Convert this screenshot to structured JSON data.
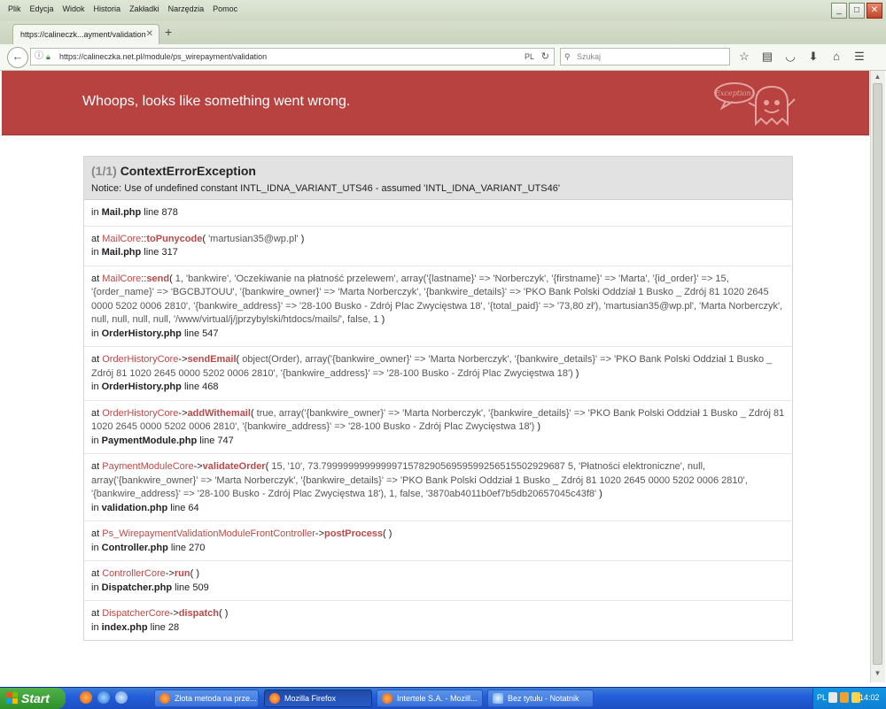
{
  "browser": {
    "menu": [
      "Plik",
      "Edycja",
      "Widok",
      "Historia",
      "Zakładki",
      "Narzędzia",
      "Pomoc"
    ],
    "tab_title": "https://calineczk...ayment/validation",
    "url": "https://calineczka.net.pl/module/ps_wirepayment/validation",
    "url_lang": "PL",
    "search_placeholder": "Szukaj"
  },
  "page": {
    "header_title": "Whoops, looks like something went wrong.",
    "logo_text": "Exception!",
    "exception": {
      "count": "(1/1)",
      "name": "ContextErrorException",
      "message": "Notice: Use of undefined constant INTL_IDNA_VARIANT_UTS46 - assumed 'INTL_IDNA_VARIANT_UTS46'"
    },
    "trace": [
      {
        "has_call": false,
        "file": "Mail.php",
        "line": "line 878"
      },
      {
        "has_call": true,
        "class": "MailCore",
        "sep": "::",
        "func": "toPunycode",
        "args": "'martusian35@wp.pl'",
        "file": "Mail.php",
        "line": "line 317"
      },
      {
        "has_call": true,
        "class": "MailCore",
        "sep": "::",
        "func": "send",
        "args": "1, 'bankwire', 'Oczekiwanie na płatność przelewem', array('{lastname}' => 'Norberczyk', '{firstname}' => 'Marta', '{id_order}' => 15, '{order_name}' => 'BGCBJTOUU', '{bankwire_owner}' => 'Marta Norberczyk', '{bankwire_details}' => 'PKO Bank Polski Oddział 1 Busko _ Zdrój 81 1020 2645 0000 5202 0006 2810', '{bankwire_address}' => '28-100 Busko - Zdrój Plac Zwycięstwa 18', '{total_paid}' => '73,80 zł'), 'martusian35@wp.pl', 'Marta Norberczyk', null, null, null, null, '/www/virtual/j/jprzybylski/htdocs/mails/', false, 1",
        "file": "OrderHistory.php",
        "line": "line 547"
      },
      {
        "has_call": true,
        "class": "OrderHistoryCore",
        "sep": "->",
        "func": "sendEmail",
        "args": "object(Order), array('{bankwire_owner}' => 'Marta Norberczyk', '{bankwire_details}' => 'PKO Bank Polski Oddział 1 Busko _ Zdrój 81 1020 2645 0000 5202 0006 2810', '{bankwire_address}' => '28-100 Busko - Zdrój Plac Zwycięstwa 18')",
        "file": "OrderHistory.php",
        "line": "line 468"
      },
      {
        "has_call": true,
        "class": "OrderHistoryCore",
        "sep": "->",
        "func": "addWithemail",
        "args": "true, array('{bankwire_owner}' => 'Marta Norberczyk', '{bankwire_details}' => 'PKO Bank Polski Oddział 1 Busko _ Zdrój 81 1020 2645 0000 5202 0006 2810', '{bankwire_address}' => '28-100 Busko - Zdrój Plac Zwycięstwa 18')",
        "file": "PaymentModule.php",
        "line": "line 747"
      },
      {
        "has_call": true,
        "class": "PaymentModuleCore",
        "sep": "->",
        "func": "validateOrder",
        "args": "15, '10', 73.799999999999997157829056959599256515502929687 5, 'Płatności elektroniczne', null, array('{bankwire_owner}' => 'Marta Norberczyk', '{bankwire_details}' => 'PKO Bank Polski Oddział 1 Busko _ Zdrój 81 1020 2645 0000 5202 0006 2810', '{bankwire_address}' => '28-100 Busko - Zdrój Plac Zwycięstwa 18'), 1, false, '3870ab4011b0ef7b5db20657045c43f8'",
        "file": "validation.php",
        "line": "line 64"
      },
      {
        "has_call": true,
        "class": "Ps_WirepaymentValidationModuleFrontController",
        "sep": "->",
        "func": "postProcess",
        "args": "",
        "file": "Controller.php",
        "line": "line 270"
      },
      {
        "has_call": true,
        "class": "ControllerCore",
        "sep": "->",
        "func": "run",
        "args": "",
        "file": "Dispatcher.php",
        "line": "line 509"
      },
      {
        "has_call": true,
        "class": "DispatcherCore",
        "sep": "->",
        "func": "dispatch",
        "args": "",
        "file": "index.php",
        "line": "line 28"
      }
    ]
  },
  "taskbar": {
    "start_label": "Start",
    "tasks": [
      {
        "label": "Złota metoda na prze...",
        "active": false,
        "color": "#e76f2a"
      },
      {
        "label": "Mozilla Firefox",
        "active": true,
        "color": "#e76f2a"
      },
      {
        "label": "Intertele S.A. - Mozill...",
        "active": false,
        "color": "#e76f2a"
      },
      {
        "label": "Bez tytułu - Notatnik",
        "active": false,
        "color": "#6aa7e8"
      }
    ],
    "lang": "PL",
    "clock": "14:02"
  },
  "colors": {
    "header_bg": "#b7423f",
    "class_link": "#b94a48"
  }
}
